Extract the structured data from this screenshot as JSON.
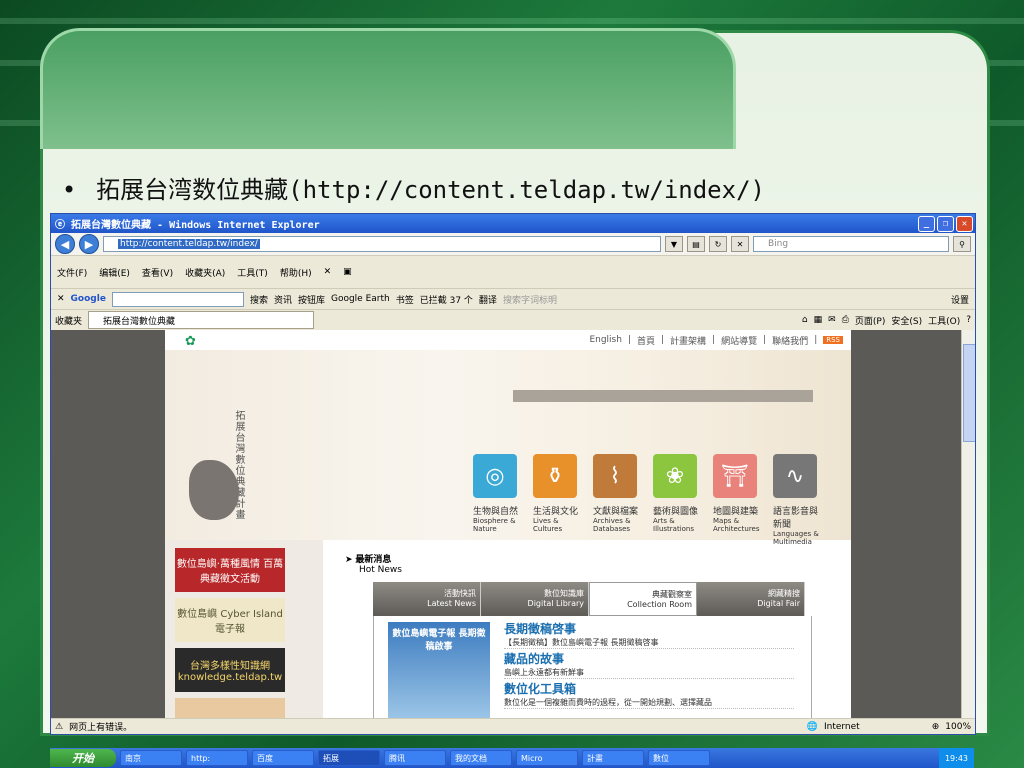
{
  "slide": {
    "bullet": "•",
    "heading": "拓展台湾数位典藏(http://content.teldap.tw/index/)"
  },
  "window": {
    "title": "拓展台灣數位典藏 - Windows Internet Explorer",
    "url": "http://content.teldap.tw/index/",
    "search_placeholder": "Bing"
  },
  "menu": [
    "文件(F)",
    "编辑(E)",
    "查看(V)",
    "收藏夹(A)",
    "工具(T)",
    "帮助(H)"
  ],
  "googlebar": {
    "brand": "Google",
    "items": [
      "搜索",
      "资讯",
      "按钮库",
      "Google Earth",
      "书签",
      "已拦截 37 个",
      "翻译",
      "搜索字词标明",
      "设置"
    ]
  },
  "favbar": {
    "favorites": "收藏夹",
    "tab": "拓展台灣數位典藏",
    "page": "页面(P)",
    "safety": "安全(S)",
    "tools": "工具(O)"
  },
  "site": {
    "toplinks": [
      "English",
      "首頁",
      "計畫架構",
      "網站導覽",
      "聯絡我們",
      "RSS"
    ],
    "banner_title": "拓展台灣數位典藏計畫",
    "categories": [
      {
        "zh": "生物與自然",
        "en": "Biosphere & Nature",
        "color": "#3aa9d6"
      },
      {
        "zh": "生活與文化",
        "en": "Lives & Cultures",
        "color": "#e8902a"
      },
      {
        "zh": "文獻與檔案",
        "en": "Archives & Databases",
        "color": "#c07a3a"
      },
      {
        "zh": "藝術與圖像",
        "en": "Arts & Illustrations",
        "color": "#8cc63f"
      },
      {
        "zh": "地圖與建築",
        "en": "Maps & Architectures",
        "color": "#e8827a"
      },
      {
        "zh": "語言影音與新聞",
        "en": "Languages & Multimedia",
        "color": "#777777"
      }
    ],
    "left_banners": [
      {
        "text": "數位島嶼‧萬種風情 百萬典藏徵文活動",
        "bg": "#b8282a",
        "fg": "#fff"
      },
      {
        "text": "數位島嶼 Cyber Island 電子報",
        "bg": "#f0e6c8",
        "fg": "#553"
      },
      {
        "text": "台灣多樣性知識網 knowledge.teldap.tw",
        "bg": "#2a2a2a",
        "fg": "#f5d56a"
      },
      {
        "text": "",
        "bg": "#e8c9a0",
        "fg": "#333"
      }
    ],
    "hot_news_zh": "最新消息",
    "hot_news_en": "Hot News",
    "tabs": [
      {
        "zh": "活動快訊",
        "en": "Latest News"
      },
      {
        "zh": "數位知識庫",
        "en": "Digital Library"
      },
      {
        "zh": "典藏觀察室",
        "en": "Collection Room"
      },
      {
        "zh": "網藏精搜",
        "en": "Digital Fair"
      }
    ],
    "news_image": "數位島嶼電子報 長期徵稿啟事",
    "news": [
      {
        "title": "長期徵稿啓事",
        "desc": "【長期徵稿】數位島嶼電子報 長期徵稿啓事"
      },
      {
        "title": "藏品的故事",
        "desc": "島嶼上永遠都有新鮮事"
      },
      {
        "title": "數位化工具箱",
        "desc": "數位化是一個複雜而費時的過程，從一開始規劃、選擇藏品"
      }
    ]
  },
  "status": {
    "left": "网页上有错误。",
    "zone": "Internet",
    "zoom": "100%"
  },
  "taskbar": {
    "start": "开始",
    "tasks": [
      "南京",
      "http:",
      "百度",
      "拓展",
      "腾讯",
      "我的文档",
      "Micro",
      "計畫",
      "數位"
    ],
    "clock": "19:43"
  }
}
